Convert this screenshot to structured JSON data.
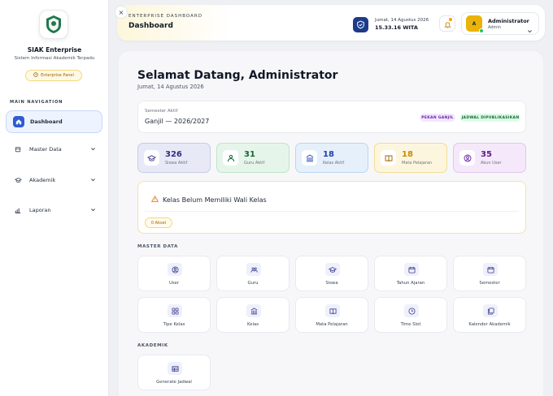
{
  "colors": {
    "accent": "#2f5bd3",
    "gold": "#eab308",
    "online": "#22c55e"
  },
  "sidebar": {
    "brand_name": "SIAK Enterprise",
    "brand_sub": "Sistem Informasi Akademik Terpadu",
    "panel_label": "Enterprise Panel",
    "nav_heading": "MAIN NAVIGATION",
    "items": [
      {
        "label": "Dashboard",
        "icon": "home-icon",
        "active": true
      },
      {
        "label": "Master Data",
        "icon": "database-icon"
      },
      {
        "label": "Akademik",
        "icon": "graduation-cap-icon"
      },
      {
        "label": "Laporan",
        "icon": "bar-chart-icon"
      }
    ]
  },
  "header": {
    "eyebrow": "ENTERPRISE DASHBOARD",
    "title": "Dashboard",
    "close_symbol": "×",
    "date": "Jumat, 14 Agustus 2026",
    "time": "15.33.16 WITA",
    "user_initial": "A",
    "user_name": "Administrator",
    "user_role": "Admin"
  },
  "main": {
    "welcome": "Selamat Datang, Administrator",
    "date": "Jumat, 14 Agustus 2026",
    "semester_label": "Semester Aktif",
    "semester_value": "Ganjil — 2026/2027",
    "badges": [
      "PEKAN GANJIL",
      "JADWAL DIPUBLIKASIKAN"
    ],
    "stats": [
      {
        "value": "326",
        "label": "Siswa Aktif",
        "icon": "graduation-cap-icon"
      },
      {
        "value": "31",
        "label": "Guru Aktif",
        "icon": "teacher-icon"
      },
      {
        "value": "18",
        "label": "Kelas Aktif",
        "icon": "building-icon"
      },
      {
        "value": "18",
        "label": "Mata Pelajaran",
        "icon": "book-icon"
      },
      {
        "value": "35",
        "label": "Akun User",
        "icon": "user-circle-icon"
      }
    ],
    "warning_title": "Kelas Belum Memiliki Wali Kelas",
    "warning_pill": "0 Aksel",
    "master_label": "MASTER DATA",
    "master_tiles": [
      {
        "label": "User",
        "icon": "user-icon"
      },
      {
        "label": "Guru",
        "icon": "teacher-icon"
      },
      {
        "label": "Siswa",
        "icon": "graduation-cap-icon"
      },
      {
        "label": "Tahun Ajaran",
        "icon": "calendar-icon"
      },
      {
        "label": "Semester",
        "icon": "calendar-icon"
      },
      {
        "label": "Tipe Kelas",
        "icon": "grid-icon"
      },
      {
        "label": "Kelas",
        "icon": "building-icon"
      },
      {
        "label": "Mata Pelajaran",
        "icon": "book-icon"
      },
      {
        "label": "Time Slot",
        "icon": "clock-icon"
      },
      {
        "label": "Kalender Akademik",
        "icon": "copy-icon"
      }
    ],
    "akademik_label": "AKADEMIK",
    "akademik_tiles": [
      {
        "label": "Generate Jadwal",
        "icon": "table-icon"
      }
    ]
  }
}
